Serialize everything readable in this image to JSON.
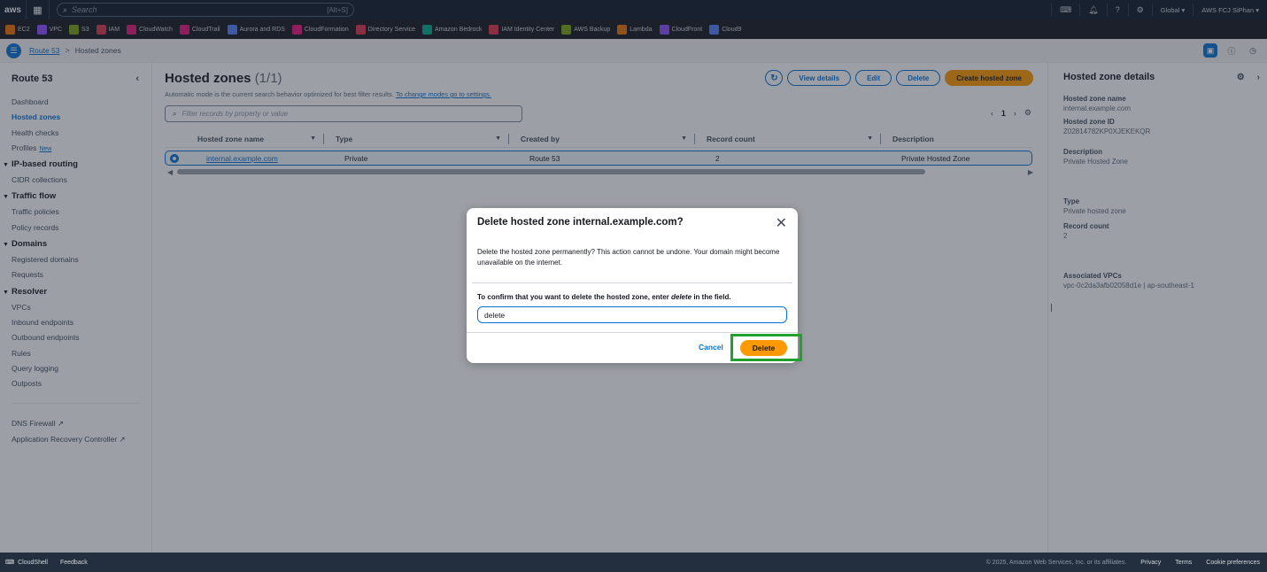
{
  "topnav": {
    "logo": "aws",
    "search_placeholder": "Search",
    "search_shortcut": "[Alt+S]",
    "region": "Global ▾",
    "account": "AWS FCJ SiPhan ▾"
  },
  "favorites": [
    {
      "label": "EC2",
      "color": "#ed7100"
    },
    {
      "label": "VPC",
      "color": "#8c4fff"
    },
    {
      "label": "S3",
      "color": "#7aa116"
    },
    {
      "label": "IAM",
      "color": "#dd344c"
    },
    {
      "label": "CloudWatch",
      "color": "#e7157b"
    },
    {
      "label": "CloudTrail",
      "color": "#e7157b"
    },
    {
      "label": "Aurora and RDS",
      "color": "#527fff"
    },
    {
      "label": "CloudFormation",
      "color": "#e7157b"
    },
    {
      "label": "Directory Service",
      "color": "#dd344c"
    },
    {
      "label": "Amazon Bedrock",
      "color": "#01a88d"
    },
    {
      "label": "IAM Identity Center",
      "color": "#dd344c"
    },
    {
      "label": "AWS Backup",
      "color": "#7aa116"
    },
    {
      "label": "Lambda",
      "color": "#ed7100"
    },
    {
      "label": "CloudFront",
      "color": "#8c4fff"
    },
    {
      "label": "Cloud9",
      "color": "#527fff"
    }
  ],
  "breadcrumb": {
    "root": "Route 53",
    "separator": ">",
    "current": "Hosted zones"
  },
  "sidenav": {
    "title": "Route 53",
    "top_items": [
      "Dashboard",
      "Hosted zones",
      "Health checks"
    ],
    "profiles": "Profiles",
    "profiles_badge": "New",
    "ip_routing": {
      "label": "IP-based routing",
      "items": [
        "CIDR collections"
      ]
    },
    "traffic_flow": {
      "label": "Traffic flow",
      "items": [
        "Traffic policies",
        "Policy records"
      ]
    },
    "domains": {
      "label": "Domains",
      "items": [
        "Registered domains",
        "Requests"
      ]
    },
    "resolver": {
      "label": "Resolver",
      "items": [
        "VPCs",
        "Inbound endpoints",
        "Outbound endpoints",
        "Rules",
        "Query logging",
        "Outposts"
      ]
    },
    "external": [
      "DNS Firewall",
      "Application Recovery Controller"
    ]
  },
  "main": {
    "title": "Hosted zones",
    "count": "(1/1)",
    "description": "Automatic mode is the current search behavior optimized for best filter results.",
    "description_link": "To change modes go to settings.",
    "actions": {
      "view_details": "View details",
      "edit": "Edit",
      "delete": "Delete",
      "create": "Create hosted zone"
    },
    "filter_placeholder": "Filter records by property or value",
    "page": "1",
    "columns": [
      "Hosted zone name",
      "Type",
      "Created by",
      "Record count",
      "Description"
    ],
    "row": [
      "internal.example.com",
      "Private",
      "Route 53",
      "2",
      "Private Hosted Zone"
    ]
  },
  "details": {
    "title": "Hosted zone details",
    "fields": [
      {
        "label": "Hosted zone name",
        "value": "internal.example.com"
      },
      {
        "label": "Hosted zone ID",
        "value": "Z02814782KP0XJEKEKQR"
      },
      {
        "label": "Description",
        "value": "Private Hosted Zone"
      },
      {
        "label": "Type",
        "value": "Private hosted zone"
      },
      {
        "label": "Record count",
        "value": "2"
      },
      {
        "label": "Associated VPCs",
        "value": "vpc-0c2da3afb02058d1e | ap-southeast-1"
      }
    ]
  },
  "modal": {
    "title": "Delete hosted zone internal.example.com?",
    "body": "Delete the hosted zone permanently? This action cannot be undone. Your domain might become unavailable on the internet.",
    "confirm_prefix": "To confirm that you want to delete the hosted zone, enter ",
    "confirm_keyword": "delete",
    "confirm_suffix": " in the field.",
    "input_value": "delete",
    "cancel": "Cancel",
    "delete": "Delete"
  },
  "footer": {
    "cloudshell": "CloudShell",
    "feedback": "Feedback",
    "copyright": "© 2025, Amazon Web Services, Inc. or its affiliates.",
    "privacy": "Privacy",
    "terms": "Terms",
    "cookies": "Cookie preferences"
  },
  "colors": {
    "accent": "#0972d3",
    "primary_button": "#ff9900",
    "highlight": "#22a02d"
  }
}
